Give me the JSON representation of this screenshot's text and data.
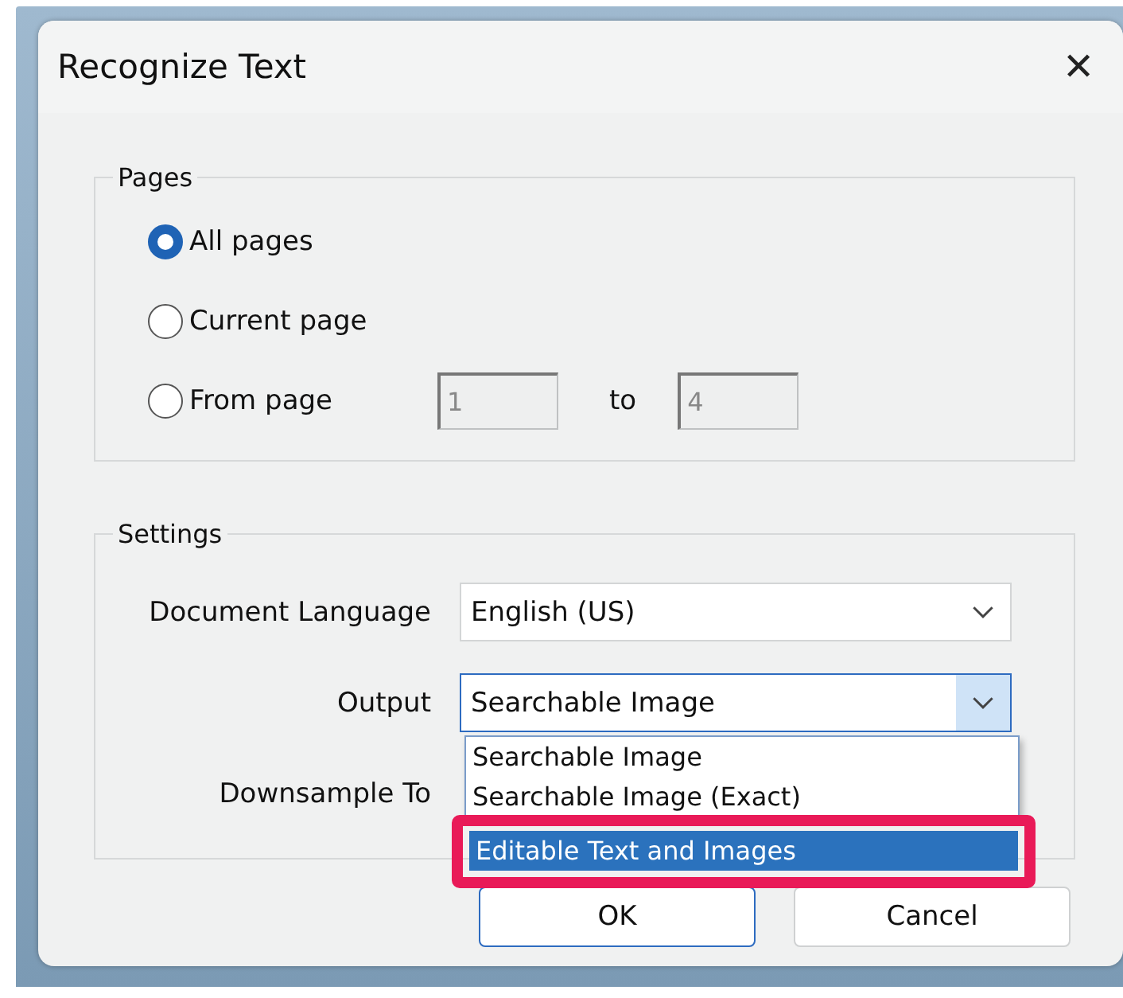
{
  "dialog": {
    "title": "Recognize Text",
    "close": "✕"
  },
  "pages": {
    "legend": "Pages",
    "options": [
      {
        "label": "All pages",
        "selected": true
      },
      {
        "label": "Current page",
        "selected": false
      },
      {
        "label": "From page",
        "selected": false
      }
    ],
    "from": "1",
    "to_label": "to",
    "to": "4"
  },
  "settings": {
    "legend": "Settings",
    "rows": [
      {
        "label": "Document Language",
        "value": "English (US)",
        "focused": false
      },
      {
        "label": "Output",
        "value": "Searchable Image",
        "focused": true
      },
      {
        "label": "Downsample To"
      }
    ]
  },
  "dropdown": {
    "items": [
      {
        "label": "Searchable Image",
        "selected": false,
        "highlighted": false
      },
      {
        "label": "Searchable Image (Exact)",
        "selected": false,
        "highlighted": false
      },
      {
        "label": "Editable Text and Images",
        "selected": true,
        "highlighted": true
      }
    ]
  },
  "buttons": [
    {
      "label": "OK",
      "default": true
    },
    {
      "label": "Cancel",
      "default": false
    }
  ]
}
